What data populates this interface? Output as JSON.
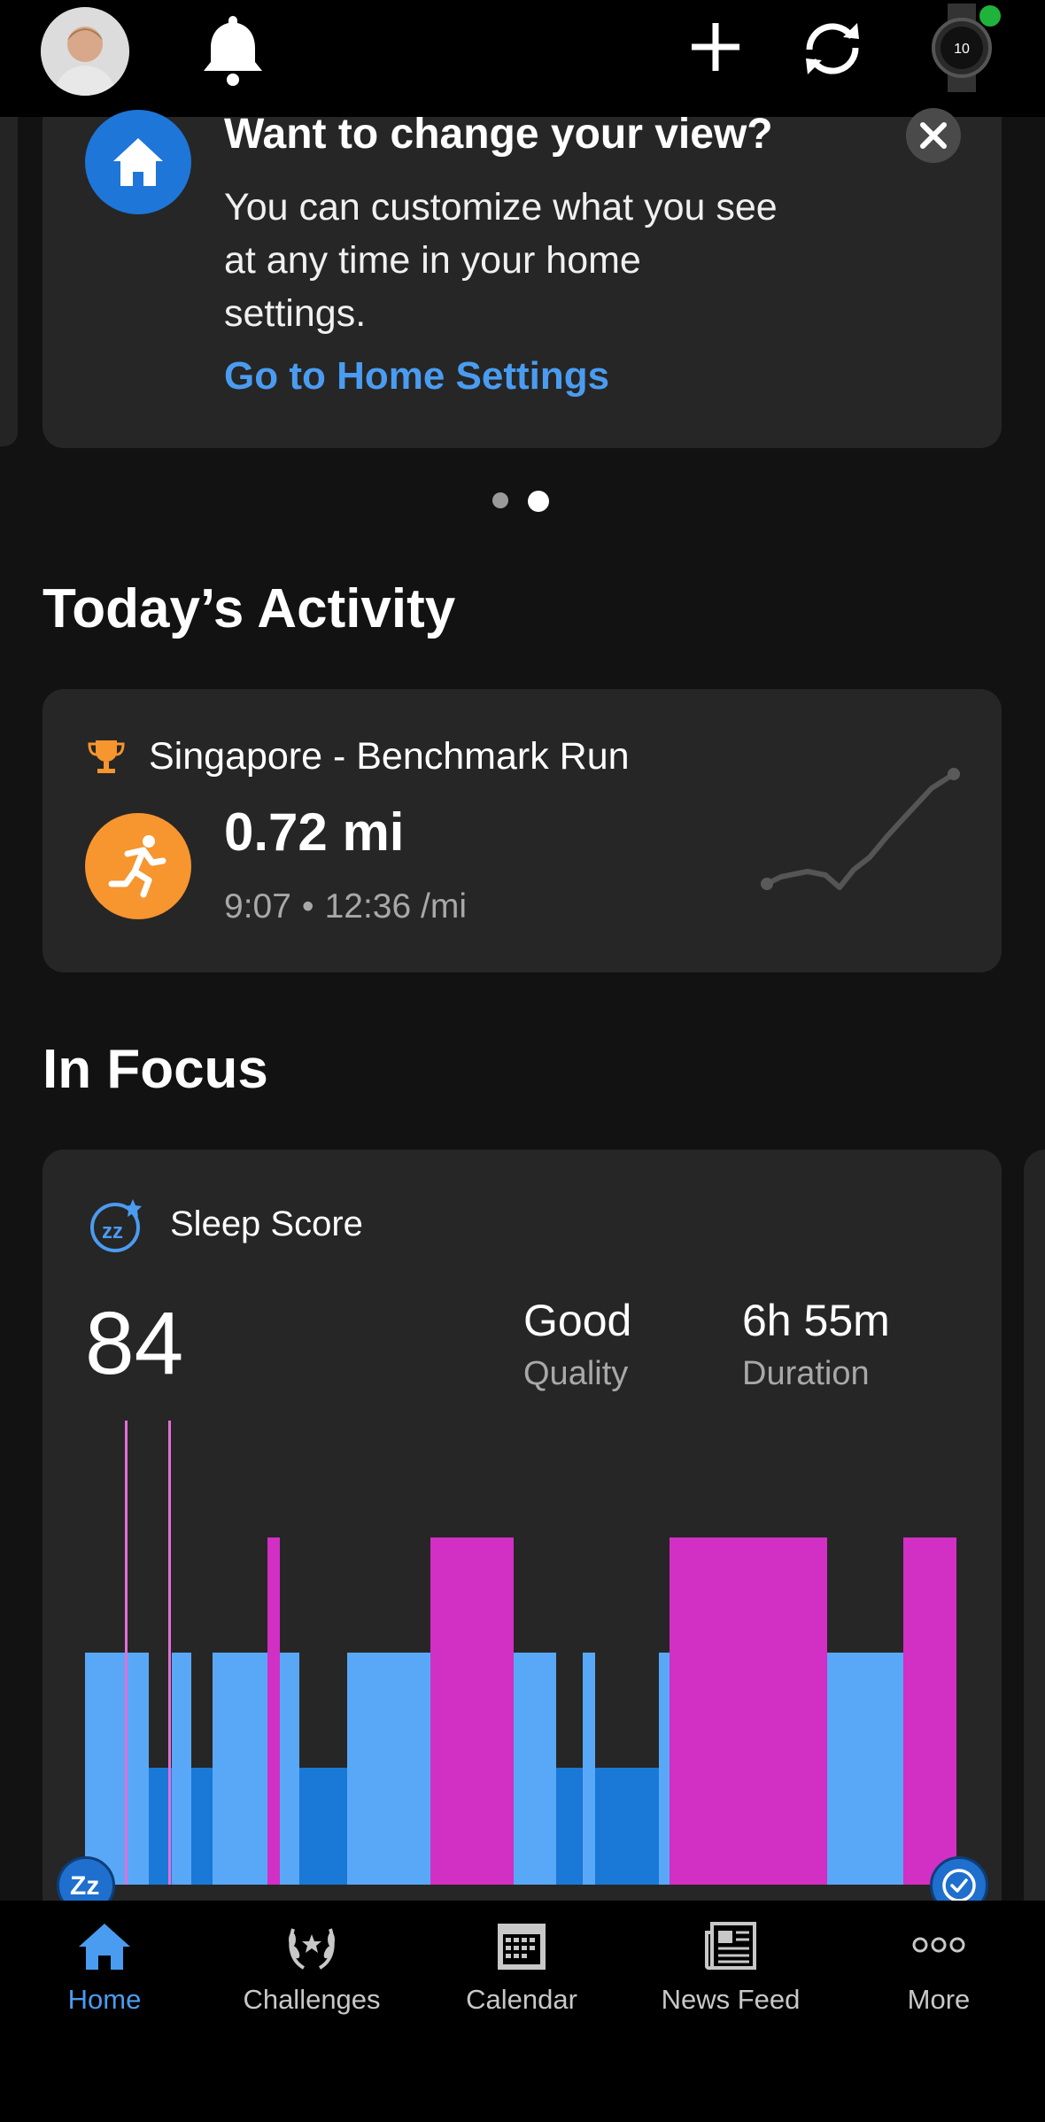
{
  "top_bar": {
    "avatar": "user-avatar",
    "icons": [
      "bell-icon",
      "plus-icon",
      "sync-icon",
      "watch-device-icon"
    ],
    "device_status_color": "#1fb33c"
  },
  "promo_card": {
    "title": "Want to change your view?",
    "body": "You can customize what you see at any time in your home settings.",
    "link": "Go to Home Settings",
    "icon": "home-icon",
    "accent": "#1d76d8",
    "link_color": "#4a9cf0"
  },
  "carousel": {
    "pages": 2,
    "active_page": 2
  },
  "todays_activity": {
    "heading": "Today’s Activity",
    "activity_name": "Singapore - Benchmark Run",
    "distance": "0.72 mi",
    "time": "9:07",
    "separator": "•",
    "pace": "12:36 /mi",
    "activity_color": "#f7952e"
  },
  "in_focus": {
    "heading": "In Focus",
    "card_title": "Sleep Score",
    "score": "84",
    "quality_value": "Good",
    "quality_label": "Quality",
    "duration_value": "6h 55m",
    "duration_label": "Duration",
    "start_badge": "Zz",
    "end_badge": "clock-icon",
    "stage_colors": {
      "light": "#59a8f8",
      "deep": "#1a78d6",
      "rem": "#d22fc4",
      "awake": "#e070d8"
    }
  },
  "bottom_nav": {
    "items": [
      {
        "label": "Home",
        "icon": "home-icon",
        "active": true
      },
      {
        "label": "Challenges",
        "icon": "laurel-icon",
        "active": false
      },
      {
        "label": "Calendar",
        "icon": "calendar-icon",
        "active": false
      },
      {
        "label": "News Feed",
        "icon": "newspaper-icon",
        "active": false
      },
      {
        "label": "More",
        "icon": "more-icon",
        "active": false
      }
    ],
    "active_color": "#4a9cf0"
  }
}
